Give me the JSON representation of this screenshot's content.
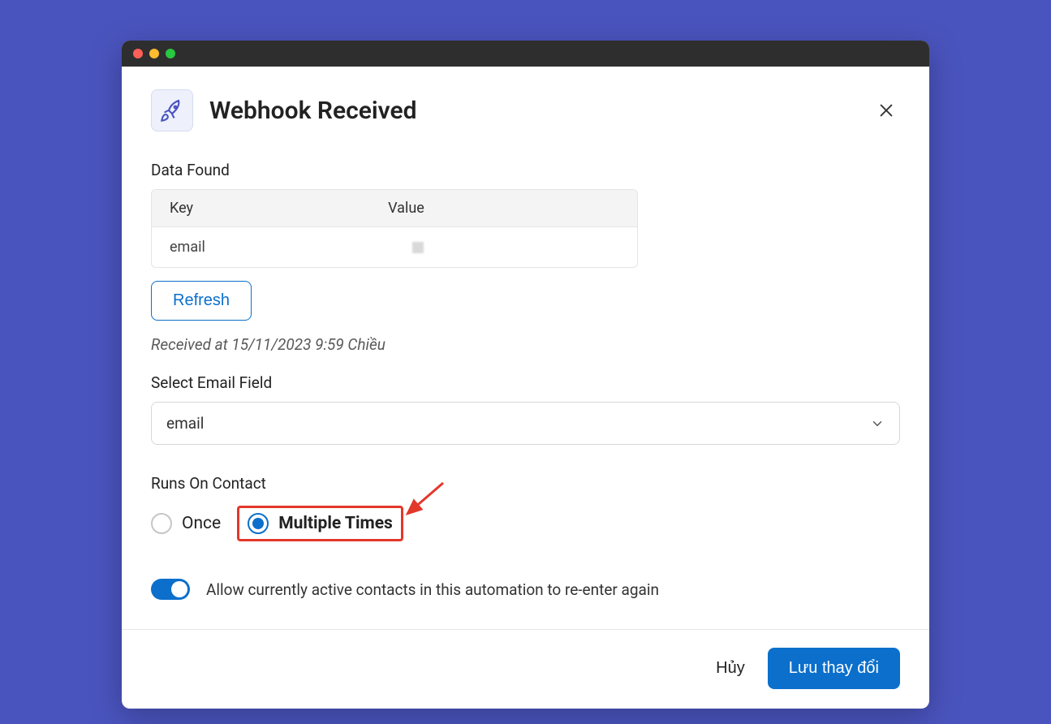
{
  "header": {
    "title": "Webhook Received"
  },
  "dataFound": {
    "label": "Data Found",
    "columns": {
      "key": "Key",
      "value": "Value"
    },
    "rows": [
      {
        "key": "email",
        "value": ""
      }
    ]
  },
  "refresh": {
    "label": "Refresh"
  },
  "receivedAt": "Received at 15/11/2023 9:59 Chiều",
  "emailField": {
    "label": "Select Email Field",
    "selected": "email"
  },
  "runsOnContact": {
    "label": "Runs On Contact",
    "options": {
      "once": "Once",
      "multiple": "Multiple Times"
    },
    "selected": "multiple"
  },
  "allowReenter": {
    "label": "Allow currently active contacts in this automation to re-enter again",
    "enabled": true
  },
  "footer": {
    "cancel": "Hủy",
    "save": "Lưu thay đổi"
  }
}
